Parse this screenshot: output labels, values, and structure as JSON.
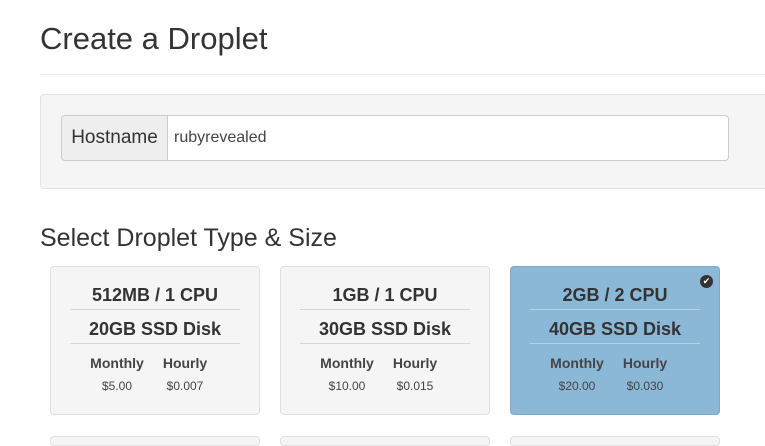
{
  "page": {
    "title": "Create a Droplet"
  },
  "hostname": {
    "label": "Hostname",
    "value": "rubyrevealed"
  },
  "size_section": {
    "title": "Select Droplet Type & Size",
    "monthly_label": "Monthly",
    "hourly_label": "Hourly",
    "cards": [
      {
        "memory_cpu": "512MB / 1 CPU",
        "disk": "20GB SSD Disk",
        "monthly": "$5.00",
        "hourly": "$0.007",
        "selected": false
      },
      {
        "memory_cpu": "1GB / 1 CPU",
        "disk": "30GB SSD Disk",
        "monthly": "$10.00",
        "hourly": "$0.015",
        "selected": false
      },
      {
        "memory_cpu": "2GB / 2 CPU",
        "disk": "40GB SSD Disk",
        "monthly": "$20.00",
        "hourly": "$0.030",
        "selected": true
      }
    ],
    "selected_icon": "check-circle-icon"
  },
  "colors": {
    "card_bg": "#f5f5f5",
    "selected_card_bg": "#8cb8d8",
    "panel_bg": "#f5f5f5"
  }
}
